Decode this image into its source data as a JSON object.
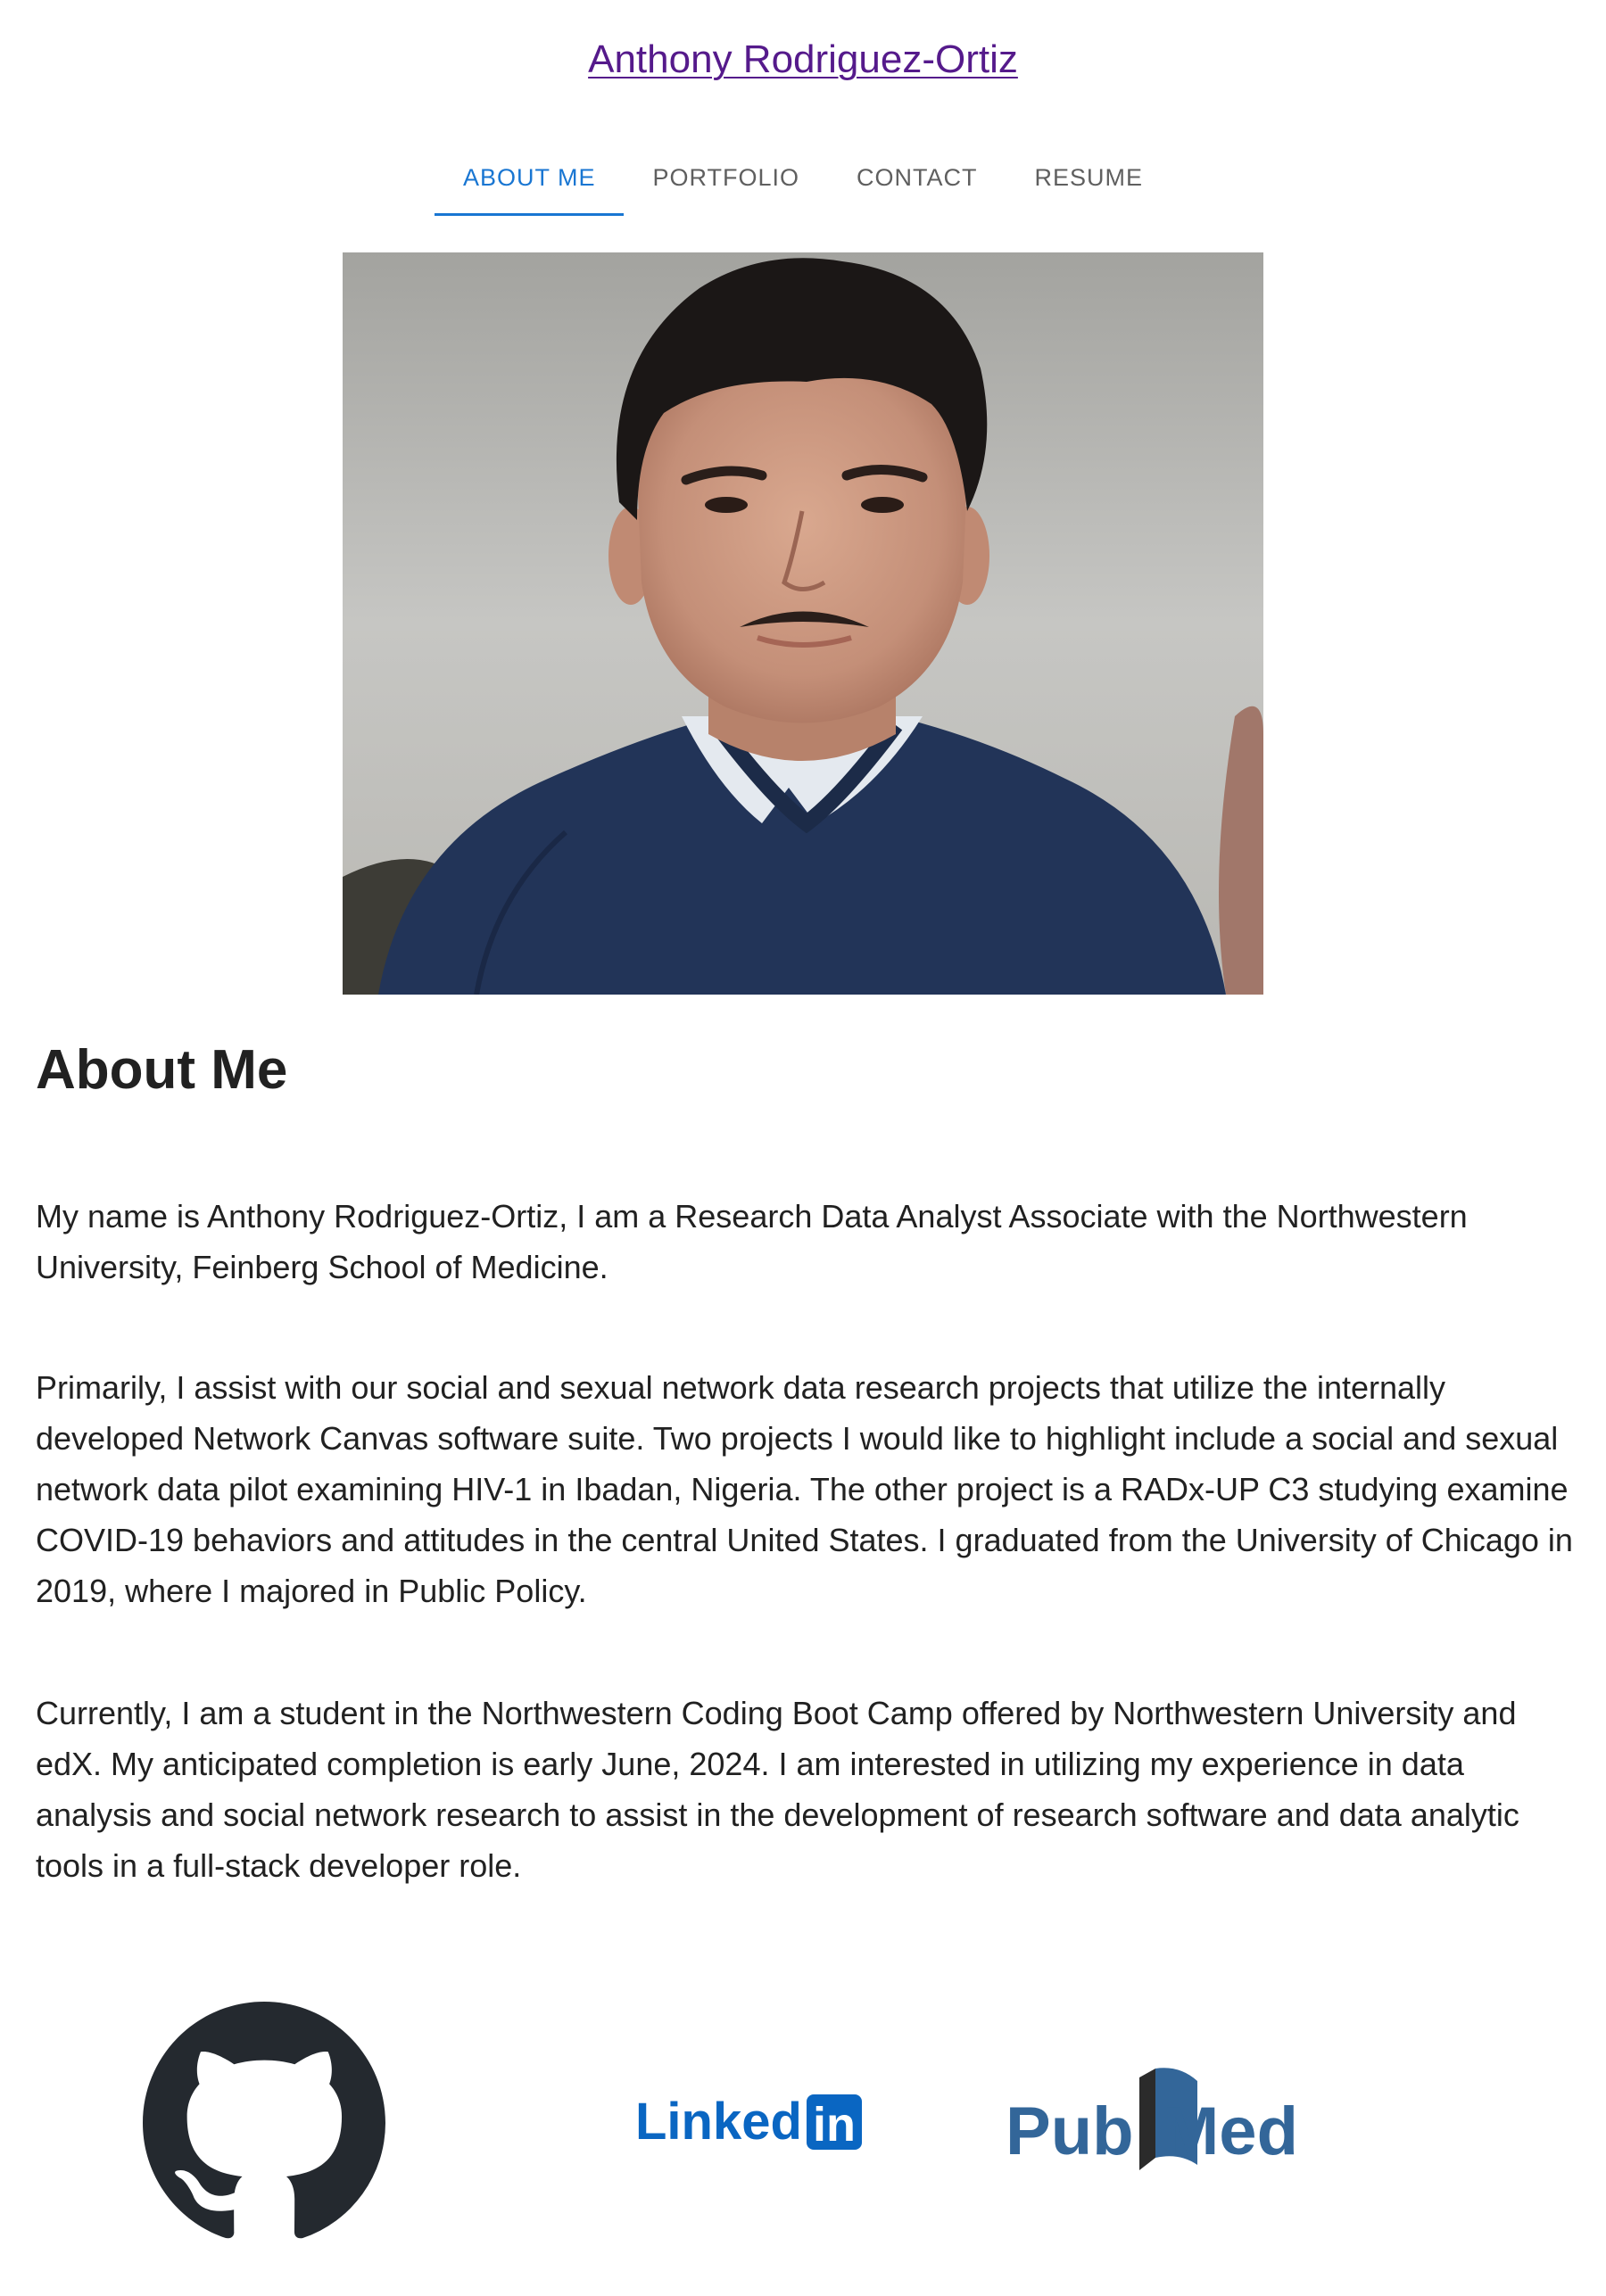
{
  "header": {
    "site_title": "Anthony Rodriguez-Ortiz"
  },
  "nav": {
    "tabs": [
      {
        "label": "ABOUT ME",
        "active": true
      },
      {
        "label": "PORTFOLIO",
        "active": false
      },
      {
        "label": "CONTACT",
        "active": false
      },
      {
        "label": "RESUME",
        "active": false
      }
    ]
  },
  "profile_photo": {
    "alt": "Portrait photo"
  },
  "about": {
    "heading": "About Me",
    "paragraphs": [
      "My name is Anthony Rodriguez-Ortiz, I am a Research Data Analyst Associate with the Northwestern University, Feinberg School of Medicine.",
      "Primarily, I assist with our social and sexual network data research projects that utilize the internally developed Network Canvas software suite. Two projects I would like to highlight include a social and sexual network data pilot examining HIV-1 in Ibadan, Nigeria. The other project is a RADx-UP C3 studying examine COVID-19 behaviors and attitudes in the central United States. I graduated from the University of Chicago in 2019, where I majored in Public Policy.",
      "Currently, I am a student in the Northwestern Coding Boot Camp offered by Northwestern University and edX. My anticipated completion is early June, 2024. I am interested in utilizing my experience in data analysis and social network research to assist in the development of research software and data analytic tools in a full-stack developer role."
    ]
  },
  "social_links": {
    "github_icon": "github-icon",
    "linkedin_logo": "LinkedIn",
    "pubmed_logo": "PubMed"
  },
  "colors": {
    "accent": "#1976d2",
    "link_visited": "#551a8b",
    "linkedin_blue": "#0a66c2",
    "pubmed_blue": "#336699",
    "github_dark": "#24292f"
  }
}
